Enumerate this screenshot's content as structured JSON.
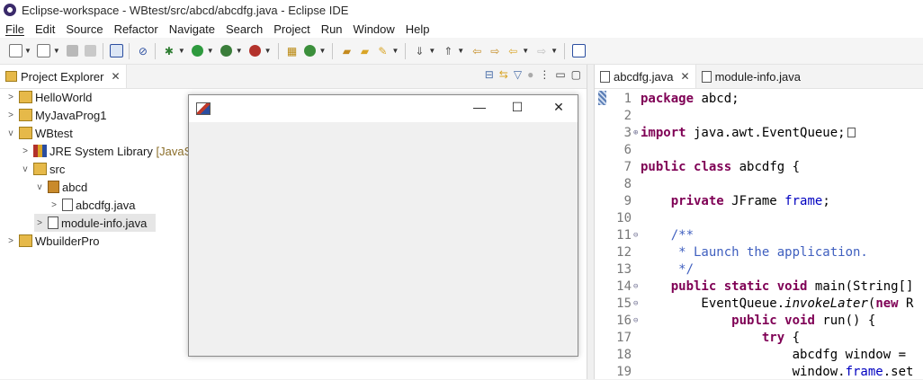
{
  "window": {
    "title": "Eclipse-workspace - WBtest/src/abcd/abcdfg.java - Eclipse IDE"
  },
  "menu": [
    "File",
    "Edit",
    "Source",
    "Refactor",
    "Navigate",
    "Search",
    "Project",
    "Run",
    "Window",
    "Help"
  ],
  "project_explorer": {
    "tab_label": "Project Explorer",
    "tree": [
      {
        "label": "HelloWorld"
      },
      {
        "label": "MyJavaProg1"
      },
      {
        "label": "WBtest"
      },
      {
        "label": "JRE System Library",
        "suffix": "[JavaSE"
      },
      {
        "label": "src"
      },
      {
        "label": "abcd"
      },
      {
        "label": "abcdfg.java"
      },
      {
        "label": "module-info.java"
      },
      {
        "label": "WbuilderPro"
      }
    ]
  },
  "editor": {
    "tabs": [
      {
        "label": "abcdfg.java"
      },
      {
        "label": "module-info.java"
      }
    ],
    "lines": [
      {
        "num": "1",
        "code": "package abcd;"
      },
      {
        "num": "2",
        "code": ""
      },
      {
        "num": "3",
        "code": "import java.awt.EventQueue;"
      },
      {
        "num": "6",
        "code": ""
      },
      {
        "num": "7",
        "code": "public class abcdfg {"
      },
      {
        "num": "8",
        "code": ""
      },
      {
        "num": "9",
        "code": "    private JFrame frame;"
      },
      {
        "num": "10",
        "code": ""
      },
      {
        "num": "11",
        "code": "    /**"
      },
      {
        "num": "12",
        "code": "     * Launch the application."
      },
      {
        "num": "13",
        "code": "     */"
      },
      {
        "num": "14",
        "code": "    public static void main(String[]"
      },
      {
        "num": "15",
        "code": "        EventQueue.invokeLater(new R"
      },
      {
        "num": "16",
        "code": "            public void run() {"
      },
      {
        "num": "17",
        "code": "                try {"
      },
      {
        "num": "18",
        "code": "                    abcdfg window ="
      },
      {
        "num": "19",
        "code": "                    window.frame.set"
      }
    ]
  },
  "colors": {
    "keyword": "#7f0055",
    "comment": "#3f5fbf",
    "field": "#0000c0",
    "library_suffix": "#8b6e2a"
  }
}
